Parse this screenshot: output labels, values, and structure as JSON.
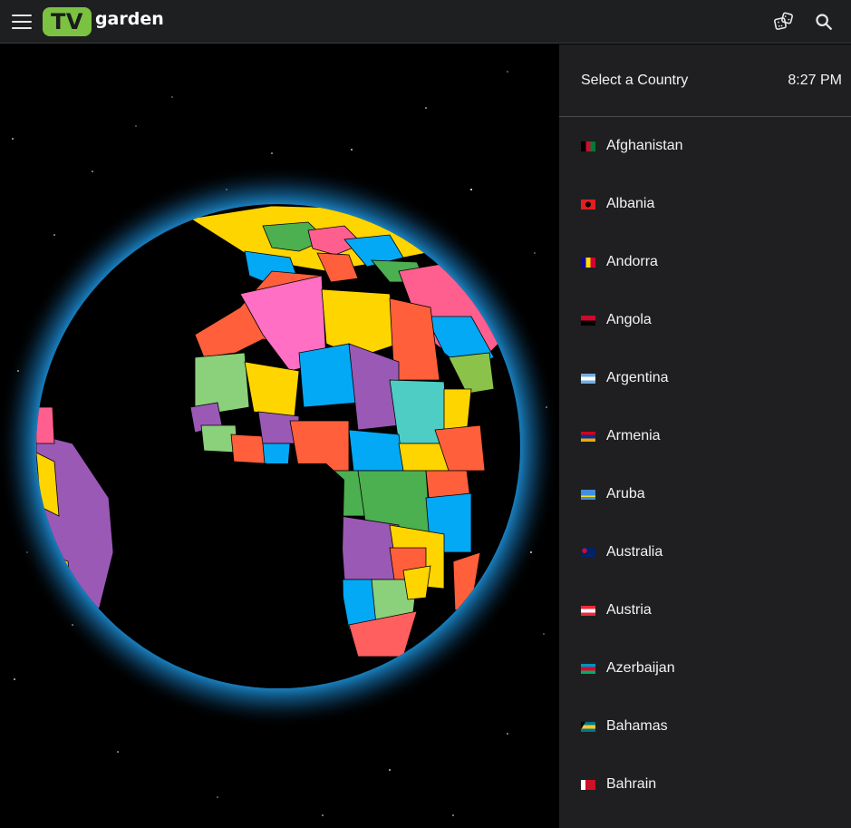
{
  "app": {
    "logo_tv": "TV",
    "logo_garden": "garden"
  },
  "icons": {
    "menu": "hamburger-menu-icon",
    "random": "dice-icon",
    "search": "search-icon"
  },
  "sidebar": {
    "title": "Select a Country",
    "time": "8:27 PM",
    "countries": [
      {
        "name": "Afghanistan",
        "flag": "afghanistan-flag-icon"
      },
      {
        "name": "Albania",
        "flag": "albania-flag-icon"
      },
      {
        "name": "Andorra",
        "flag": "andorra-flag-icon"
      },
      {
        "name": "Angola",
        "flag": "angola-flag-icon"
      },
      {
        "name": "Argentina",
        "flag": "argentina-flag-icon"
      },
      {
        "name": "Armenia",
        "flag": "armenia-flag-icon"
      },
      {
        "name": "Aruba",
        "flag": "aruba-flag-icon"
      },
      {
        "name": "Australia",
        "flag": "australia-flag-icon"
      },
      {
        "name": "Austria",
        "flag": "austria-flag-icon"
      },
      {
        "name": "Azerbaijan",
        "flag": "azerbaijan-flag-icon"
      },
      {
        "name": "Bahamas",
        "flag": "bahamas-flag-icon"
      },
      {
        "name": "Bahrain",
        "flag": "bahrain-flag-icon"
      }
    ]
  },
  "colors": {
    "brand_green": "#7cc242",
    "topbar_bg": "#1e1f21",
    "sidebar_bg": "#1f1f21",
    "globe_glow": "#1c8fd6"
  }
}
